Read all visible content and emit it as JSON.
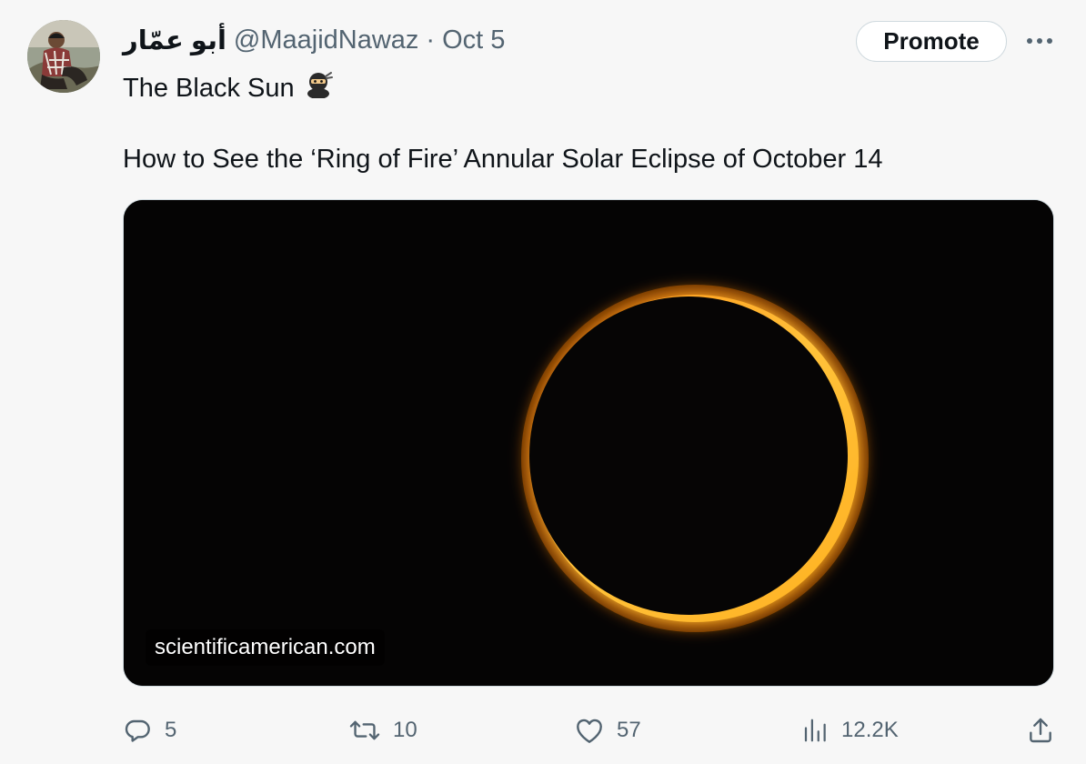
{
  "tweet": {
    "display_name": "أبو عمّار",
    "handle": "@MaajidNawaz",
    "separator": "·",
    "date": "Oct 5",
    "promote_label": "Promote",
    "text_line1": "The Black Sun",
    "text_line2": "How to See the ‘Ring of Fire’ Annular Solar Eclipse of October 14",
    "card": {
      "domain": "scientificamerican.com"
    },
    "actions": {
      "replies": "5",
      "reposts": "10",
      "likes": "57",
      "views": "12.2K"
    }
  },
  "icons": {
    "more": "more-horizontal-icon",
    "ninja": "ninja-emoji",
    "reply": "reply-icon",
    "repost": "repost-icon",
    "like": "heart-icon",
    "views": "views-icon",
    "share": "share-icon"
  },
  "colors": {
    "secondary_text": "#536471",
    "button_border": "#cfd9de",
    "ring_orange": "#ff9b1a",
    "ring_yellow": "#ffd34a"
  }
}
